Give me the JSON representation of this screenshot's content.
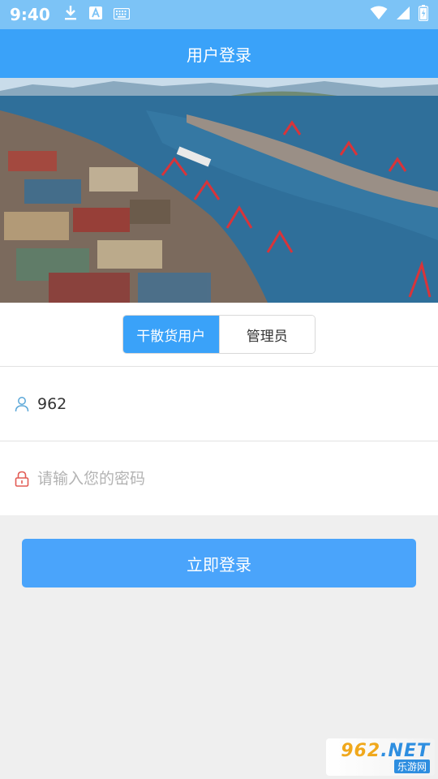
{
  "status_bar": {
    "time": "9:40",
    "left_icons": [
      "download-icon",
      "text-a-icon",
      "keyboard-icon"
    ],
    "right_icons": [
      "wifi-icon",
      "signal-icon",
      "battery-icon"
    ]
  },
  "header": {
    "title": "用户登录"
  },
  "banner": {
    "subject": "port-aerial-image"
  },
  "tabs": [
    {
      "label": "干散货用户",
      "active": true
    },
    {
      "label": "管理员",
      "active": false
    }
  ],
  "username": {
    "value": "962",
    "icon": "user-icon"
  },
  "password": {
    "placeholder": "请输入您的密码",
    "value": "",
    "icon": "lock-icon"
  },
  "login_button": {
    "label": "立即登录"
  },
  "watermark": {
    "main": "962",
    "suffix": ".NET",
    "sub": "乐游网"
  },
  "colors": {
    "primary": "#3aa2f9",
    "status_bar": "#7cc3f6",
    "button": "#4aa4fb",
    "background": "#efefef"
  }
}
